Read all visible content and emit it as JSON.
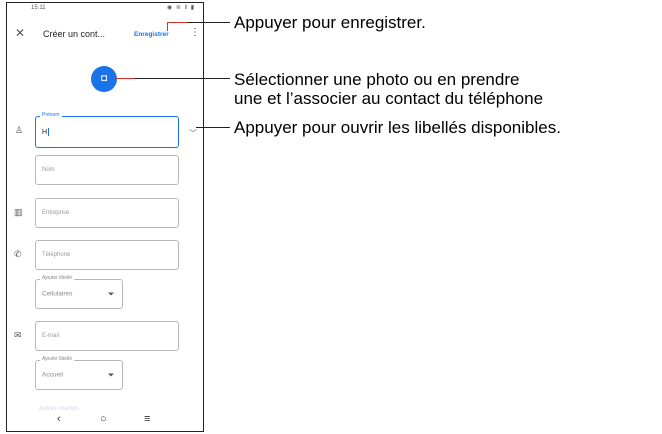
{
  "status_bar": {
    "time": "15:11",
    "icons": "◉ ≋ ‖ ▮"
  },
  "app_bar": {
    "close_icon": "close-icon",
    "title": "Créer un cont...",
    "save_label": "Enregistrer",
    "more_icon": "more-vert-icon"
  },
  "photo": {
    "icon": "add-photo-icon"
  },
  "form": {
    "prenom_label": "Prénom",
    "prenom_value": "H",
    "nom_placeholder": "Nom",
    "entreprise_placeholder": "Entreprise",
    "telephone_placeholder": "Téléphone",
    "phone_label_caption": "Ajouter libellé",
    "phone_label_value": "Cellulaires",
    "email_placeholder": "E-mail",
    "email_label_caption": "Ajouter libellé",
    "email_label_value": "Accueil",
    "faded_text": "Autres champs"
  },
  "nav": {
    "back": "‹",
    "home": "○",
    "recents": "≡"
  },
  "callouts": {
    "save": "Appuyer pour enregistrer.",
    "photo_line1": "Sélectionner une photo ou en prendre",
    "photo_line2": "une et l’associer au contact du téléphone",
    "labels": "Appuyer pour ouvrir les libellés disponibles."
  },
  "colors": {
    "accent": "#1a73e8",
    "callout_red": "#d93025"
  }
}
